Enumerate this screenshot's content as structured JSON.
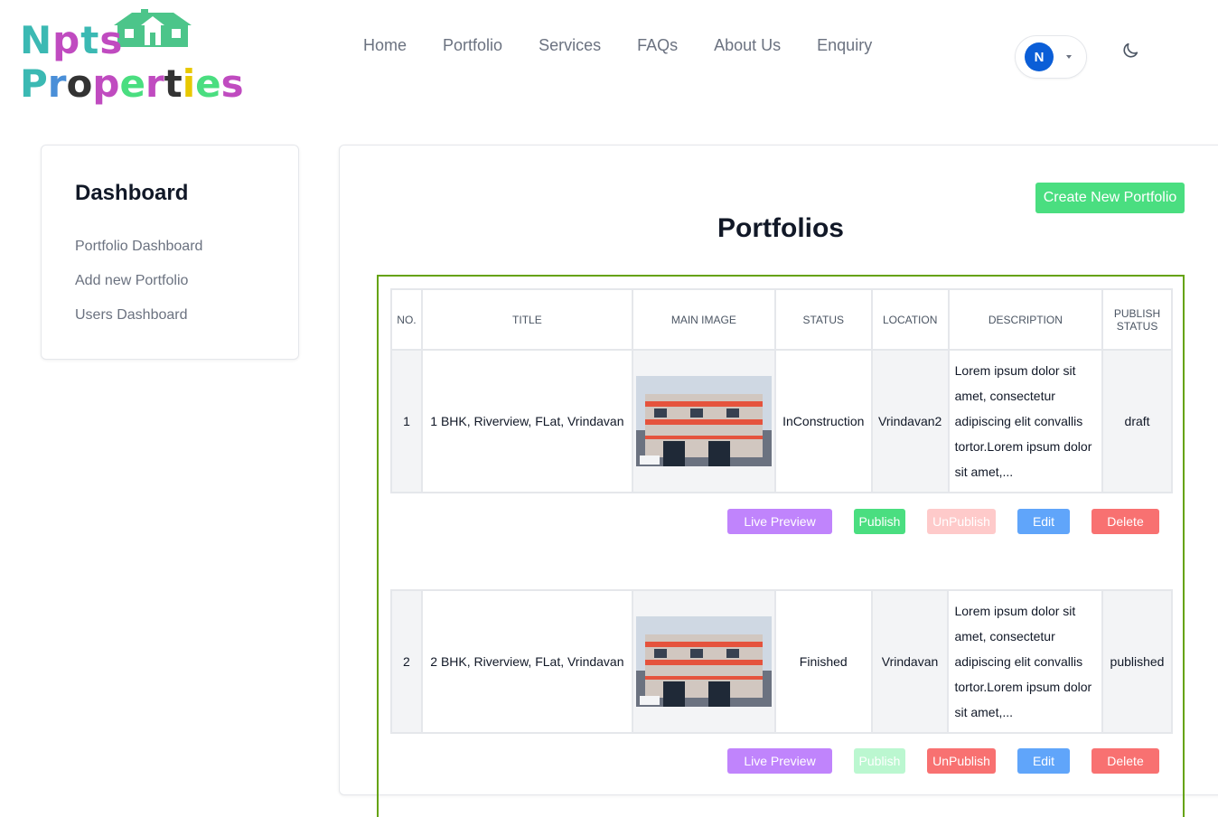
{
  "logo": {
    "line1": "Npts",
    "line2": "Properties"
  },
  "nav": [
    "Home",
    "Portfolio",
    "Services",
    "FAQs",
    "About Us",
    "Enquiry"
  ],
  "user": {
    "initial": "N"
  },
  "colors": {
    "accent_green": "#4ade80",
    "frame_green": "#65a30d",
    "avatar_blue": "#0b5ed7",
    "purple": "#c084fc",
    "blue": "#60a5fa",
    "red": "#f87171"
  },
  "sidebar": {
    "title": "Dashboard",
    "items": [
      "Portfolio Dashboard",
      "Add new Portfolio",
      "Users Dashboard"
    ]
  },
  "main": {
    "create_button": "Create New Portfolio",
    "title": "Portfolios"
  },
  "table": {
    "headers": [
      "NO.",
      "TITLE",
      "MAIN IMAGE",
      "STATUS",
      "LOCATION",
      "DESCRIPTION",
      "PUBLISH STATUS"
    ],
    "rows": [
      {
        "no": "1",
        "title": "1 BHK, Riverview, FLat, Vrindavan",
        "status": "InConstruction",
        "location": "Vrindavan2",
        "description": "Lorem ipsum dolor sit amet, consectetur adipiscing elit convallis tortor.Lorem ipsum dolor sit amet,...",
        "publish_status": "draft"
      },
      {
        "no": "2",
        "title": "2 BHK, Riverview, FLat, Vrindavan",
        "status": "Finished",
        "location": "Vrindavan",
        "description": "Lorem ipsum dolor sit amet, consectetur adipiscing elit convallis tortor.Lorem ipsum dolor sit amet,...",
        "publish_status": "published"
      }
    ]
  },
  "actions": {
    "live_preview": "Live Preview",
    "publish": "Publish",
    "unpublish": "UnPublish",
    "edit": "Edit",
    "delete": "Delete"
  }
}
